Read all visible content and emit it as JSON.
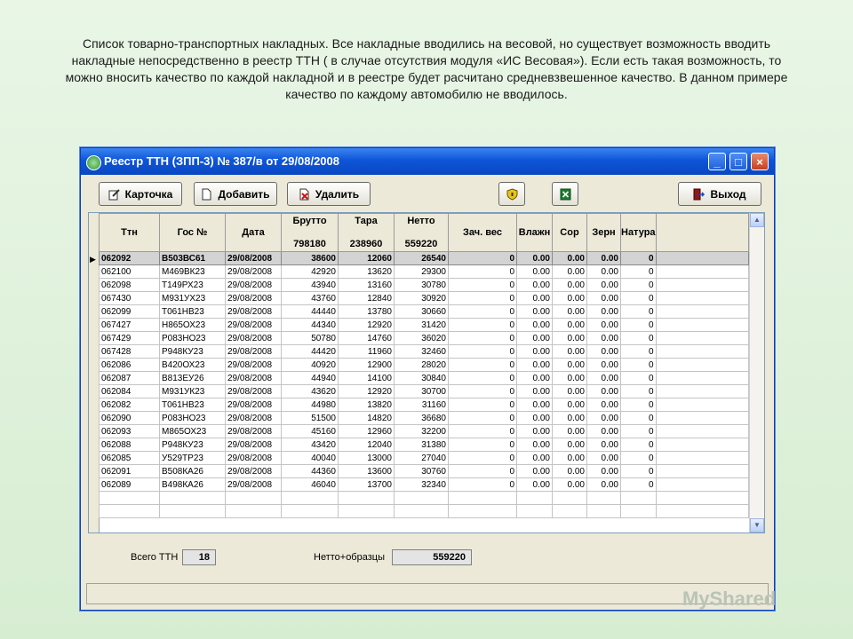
{
  "caption": "Список товарно-транспортных накладных. Все накладные вводились на весовой, но существует возможность вводить накладные непосредственно в реестр ТТН ( в случае отсутствия модуля «ИС Весовая»). Если есть такая возможность, то можно вносить качество по каждой накладной и в реестре будет расчитано средневзвешенное качество. В данном примере качество по каждому автомобилю не вводилось.",
  "window": {
    "title": "Реестр ТТН (ЗПП-3) № 387/в от 29/08/2008",
    "minimize": "_",
    "maximize": "□",
    "close": "×"
  },
  "toolbar": {
    "card_label": "Карточка",
    "add_label": "Добавить",
    "delete_label": "Удалить",
    "exit_label": "Выход"
  },
  "icons": {
    "card": "edit-card-icon",
    "add": "document-icon",
    "delete": "delete-icon",
    "shield": "shield-icon",
    "excel": "excel-icon",
    "exit": "exit-door-icon"
  },
  "columns": {
    "ttn": "Ттн",
    "gos": "Гос №",
    "date": "Дата",
    "brutto": "Брутто",
    "brutto_total": "798180",
    "tara": "Тара",
    "tara_total": "238960",
    "netto": "Нетто",
    "netto_total": "559220",
    "zach": "Зач. вес",
    "vlazh": "Влажн",
    "sor": "Сор",
    "zern": "Зерн",
    "natura": "Натура"
  },
  "rows": [
    [
      "062092",
      "В503ВС61",
      "29/08/2008",
      "38600",
      "12060",
      "26540",
      "0",
      "0.00",
      "0.00",
      "0.00",
      "0"
    ],
    [
      "062100",
      "М469ВК23",
      "29/08/2008",
      "42920",
      "13620",
      "29300",
      "0",
      "0.00",
      "0.00",
      "0.00",
      "0"
    ],
    [
      "062098",
      "Т149РХ23",
      "29/08/2008",
      "43940",
      "13160",
      "30780",
      "0",
      "0.00",
      "0.00",
      "0.00",
      "0"
    ],
    [
      "067430",
      "М931УХ23",
      "29/08/2008",
      "43760",
      "12840",
      "30920",
      "0",
      "0.00",
      "0.00",
      "0.00",
      "0"
    ],
    [
      "062099",
      "Т061НВ23",
      "29/08/2008",
      "44440",
      "13780",
      "30660",
      "0",
      "0.00",
      "0.00",
      "0.00",
      "0"
    ],
    [
      "067427",
      "Н865ОХ23",
      "29/08/2008",
      "44340",
      "12920",
      "31420",
      "0",
      "0.00",
      "0.00",
      "0.00",
      "0"
    ],
    [
      "067429",
      "Р083НО23",
      "29/08/2008",
      "50780",
      "14760",
      "36020",
      "0",
      "0.00",
      "0.00",
      "0.00",
      "0"
    ],
    [
      "067428",
      "Р948КУ23",
      "29/08/2008",
      "44420",
      "11960",
      "32460",
      "0",
      "0.00",
      "0.00",
      "0.00",
      "0"
    ],
    [
      "062086",
      "В420ОХ23",
      "29/08/2008",
      "40920",
      "12900",
      "28020",
      "0",
      "0.00",
      "0.00",
      "0.00",
      "0"
    ],
    [
      "062087",
      "В813ЕУ26",
      "29/08/2008",
      "44940",
      "14100",
      "30840",
      "0",
      "0.00",
      "0.00",
      "0.00",
      "0"
    ],
    [
      "062084",
      "М931УК23",
      "29/08/2008",
      "43620",
      "12920",
      "30700",
      "0",
      "0.00",
      "0.00",
      "0.00",
      "0"
    ],
    [
      "062082",
      "Т061НВ23",
      "29/08/2008",
      "44980",
      "13820",
      "31160",
      "0",
      "0.00",
      "0.00",
      "0.00",
      "0"
    ],
    [
      "062090",
      "Р083НО23",
      "29/08/2008",
      "51500",
      "14820",
      "36680",
      "0",
      "0.00",
      "0.00",
      "0.00",
      "0"
    ],
    [
      "062093",
      "М865ОХ23",
      "29/08/2008",
      "45160",
      "12960",
      "32200",
      "0",
      "0.00",
      "0.00",
      "0.00",
      "0"
    ],
    [
      "062088",
      "Р948КУ23",
      "29/08/2008",
      "43420",
      "12040",
      "31380",
      "0",
      "0.00",
      "0.00",
      "0.00",
      "0"
    ],
    [
      "062085",
      "У529ТР23",
      "29/08/2008",
      "40040",
      "13000",
      "27040",
      "0",
      "0.00",
      "0.00",
      "0.00",
      "0"
    ],
    [
      "062091",
      "В508КА26",
      "29/08/2008",
      "44360",
      "13600",
      "30760",
      "0",
      "0.00",
      "0.00",
      "0.00",
      "0"
    ],
    [
      "062089",
      "В498КА26",
      "29/08/2008",
      "46040",
      "13700",
      "32340",
      "0",
      "0.00",
      "0.00",
      "0.00",
      "0"
    ]
  ],
  "footer": {
    "total_label": "Всего ТТН",
    "total_value": "18",
    "netto_label": "Нетто+образцы",
    "netto_value": "559220"
  },
  "watermark": "MyShared"
}
